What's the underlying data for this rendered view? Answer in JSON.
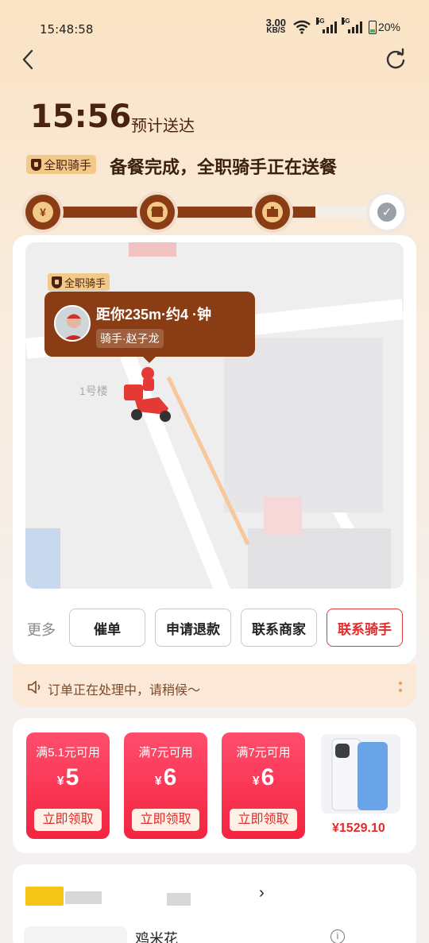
{
  "status_bar": {
    "time": "15:48:58",
    "speed_value": "3.00",
    "speed_unit": "KB/S",
    "network1": "5G",
    "network2": "5G",
    "battery": "20%"
  },
  "header": {
    "eta_time": "15:56",
    "eta_label": "预计送达",
    "rider_tag": "全职骑手",
    "status_text": "备餐完成，全职骑手正在送餐"
  },
  "progress": {
    "fraction": 0.8,
    "steps": [
      {
        "icon": "yuan-icon",
        "label": "¥",
        "done": true
      },
      {
        "icon": "shop-icon",
        "label": "",
        "done": true
      },
      {
        "icon": "package-icon",
        "label": "",
        "done": true
      },
      {
        "icon": "check-icon",
        "label": "✓",
        "done": false
      }
    ]
  },
  "map": {
    "bubble_tag": "全职骑手",
    "bubble_title": "距你235m·约4  ·钟",
    "bubble_sub": "骑手·赵子龙",
    "building_label": "1号楼"
  },
  "actions": {
    "more_label": "更多",
    "buttons": [
      "催单",
      "申请退款",
      "联系商家",
      "联系骑手"
    ]
  },
  "notice": {
    "text": "订单正在处理中，请稍候～"
  },
  "coupons": [
    {
      "condition": "满5.1元可用",
      "currency": "¥",
      "amount": "5",
      "button": "立即领取"
    },
    {
      "condition": "满7元可用",
      "currency": "¥",
      "amount": "6",
      "button": "立即领取"
    },
    {
      "condition": "满7元可用",
      "currency": "¥",
      "amount": "6",
      "button": "立即领取"
    }
  ],
  "promo_product": {
    "price": "¥1529.10"
  },
  "order": {
    "item_name": "鸡米花",
    "chevron": "›"
  },
  "colors": {
    "brown": "#8a3d15",
    "gold": "#f3c98a",
    "red": "#e22b2b"
  }
}
